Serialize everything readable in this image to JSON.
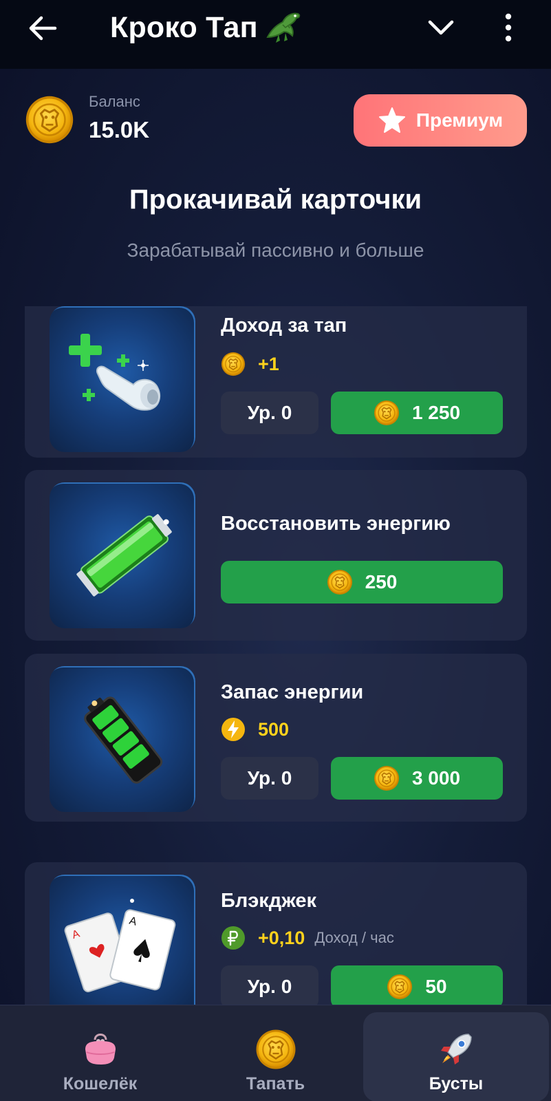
{
  "header": {
    "title": "Кроко Тап",
    "back_icon": "arrow-left-icon",
    "title_icon": "crocodile-icon",
    "dropdown_icon": "chevron-down-icon",
    "menu_icon": "more-vertical-icon"
  },
  "balance": {
    "label": "Баланс",
    "value": "15.0K",
    "icon": "croc-coin-icon"
  },
  "premium": {
    "label": "Премиум",
    "icon": "star-icon"
  },
  "section": {
    "title": "Прокачивай карточки",
    "subtitle": "Зарабатывай пассивно и больше"
  },
  "cards": [
    {
      "title": "Доход за тап",
      "stat_icon": "croc-coin-icon",
      "stat_value": "+1",
      "level": "Ур. 0",
      "price": "1 250"
    },
    {
      "title": "Восстановить энергию",
      "price": "250"
    },
    {
      "title": "Запас энергии",
      "stat_icon": "lightning-icon",
      "stat_value": "500",
      "level": "Ур. 0",
      "price": "3 000"
    },
    {
      "title": "Блэкджек",
      "stat_icon": "ruble-icon",
      "stat_value": "+0,10",
      "stat_note": "Доход / час",
      "level": "Ур. 0",
      "price": "50"
    }
  ],
  "nav": [
    {
      "label": "Кошелёк",
      "icon": "wallet-purse-icon"
    },
    {
      "label": "Тапать",
      "icon": "croc-coin-icon"
    },
    {
      "label": "Бусты",
      "icon": "rocket-icon"
    }
  ],
  "colors": {
    "background": "#141c38",
    "topbar": "#050914",
    "card": "#262c48",
    "buy_button": "#23a04a",
    "premium_start": "#ff7478",
    "premium_end": "#ff9b8c",
    "coin": "#f5b60f",
    "stat_text": "#ffd21c",
    "nav_bar": "#1f2438"
  }
}
